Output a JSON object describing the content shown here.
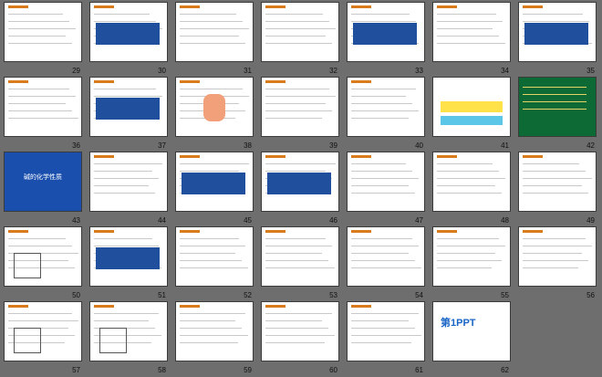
{
  "slides": [
    {
      "n": "29",
      "kind": "text"
    },
    {
      "n": "30",
      "kind": "table"
    },
    {
      "n": "31",
      "kind": "text-red"
    },
    {
      "n": "32",
      "kind": "text"
    },
    {
      "n": "33",
      "kind": "table"
    },
    {
      "n": "34",
      "kind": "text"
    },
    {
      "n": "35",
      "kind": "table"
    },
    {
      "n": "36",
      "kind": "text"
    },
    {
      "n": "37",
      "kind": "table"
    },
    {
      "n": "38",
      "kind": "hand"
    },
    {
      "n": "39",
      "kind": "text"
    },
    {
      "n": "40",
      "kind": "text"
    },
    {
      "n": "41",
      "kind": "colorful"
    },
    {
      "n": "42",
      "kind": "green"
    },
    {
      "n": "43",
      "kind": "dark",
      "title": "碱的化学性质"
    },
    {
      "n": "44",
      "kind": "text"
    },
    {
      "n": "45",
      "kind": "table"
    },
    {
      "n": "46",
      "kind": "table"
    },
    {
      "n": "47",
      "kind": "text"
    },
    {
      "n": "48",
      "kind": "text"
    },
    {
      "n": "49",
      "kind": "text"
    },
    {
      "n": "50",
      "kind": "diagram"
    },
    {
      "n": "51",
      "kind": "table"
    },
    {
      "n": "52",
      "kind": "text"
    },
    {
      "n": "53",
      "kind": "text"
    },
    {
      "n": "54",
      "kind": "text"
    },
    {
      "n": "55",
      "kind": "text"
    },
    {
      "n": "56",
      "kind": "text"
    },
    {
      "n": "57",
      "kind": "diagram"
    },
    {
      "n": "58",
      "kind": "diagram"
    },
    {
      "n": "59",
      "kind": "text"
    },
    {
      "n": "60",
      "kind": "text"
    },
    {
      "n": "61",
      "kind": "text"
    },
    {
      "n": "62",
      "kind": "logo",
      "title": "第1PPT"
    }
  ],
  "accent": "#d97a1b",
  "table_color": "#1f4f9d"
}
